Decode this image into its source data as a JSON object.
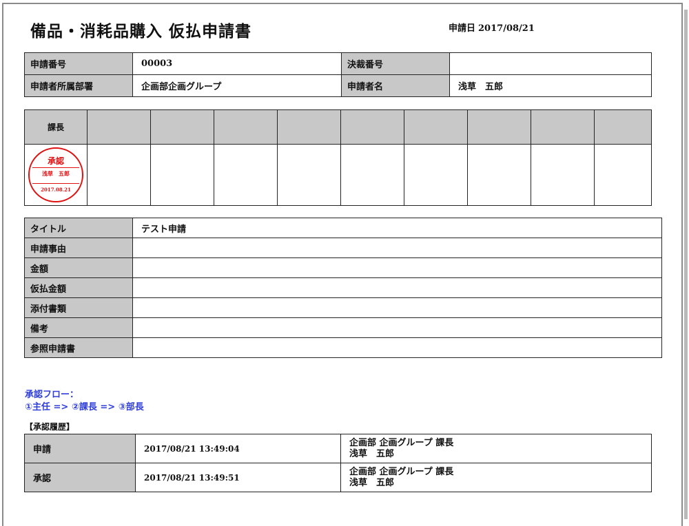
{
  "document": {
    "title": "備品・消耗品購入 仮払申請書",
    "date_label": "申請日",
    "date_value": "2017/08/21"
  },
  "header": {
    "application_no_label": "申請番号",
    "application_no_value": "00003",
    "decision_no_label": "決裁番号",
    "decision_no_value": "",
    "department_label": "申請者所属部署",
    "department_value": "企画部企画グループ",
    "applicant_label": "申請者名",
    "applicant_value": "浅草　五郎"
  },
  "approval": {
    "first_role": "課長",
    "stamp": {
      "status": "承認",
      "name": "浅草　五郎",
      "date": "2017.08.21",
      "color": "#e01010"
    }
  },
  "details": {
    "rows": [
      {
        "label": "タイトル",
        "value": "テスト申請"
      },
      {
        "label": "申請事由",
        "value": ""
      },
      {
        "label": "金額",
        "value": ""
      },
      {
        "label": "仮払金額",
        "value": ""
      },
      {
        "label": "添付書類",
        "value": ""
      },
      {
        "label": "備考",
        "value": ""
      },
      {
        "label": "参照申請書",
        "value": ""
      }
    ]
  },
  "flow": {
    "title": "承認フロー：",
    "steps": "①主任 => ②課長 => ③部長",
    "color": "#2f3fd9"
  },
  "history": {
    "heading": "【承認履歴】",
    "rows": [
      {
        "action": "申請",
        "datetime": "2017/08/21 13:49:04",
        "dept": "企画部 企画グループ 課長",
        "name": "浅草　五郎"
      },
      {
        "action": "承認",
        "datetime": "2017/08/21 13:49:51",
        "dept": "企画部 企画グループ 課長",
        "name": "浅草　五郎"
      }
    ]
  }
}
